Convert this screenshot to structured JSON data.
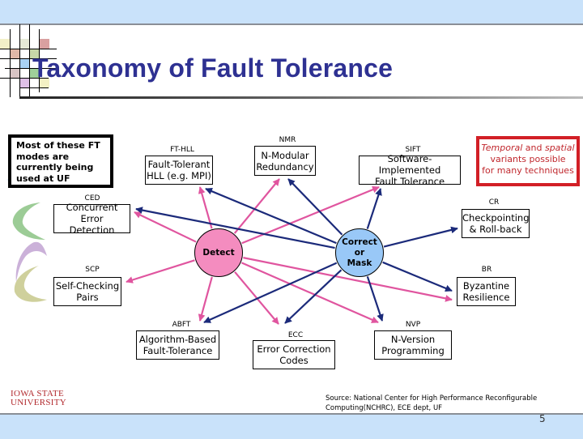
{
  "slide": {
    "title": "Taxonomy of Fault Tolerance",
    "page_number": "5",
    "logo": {
      "line1": "IOWA STATE",
      "line2": "UNIVERSITY"
    },
    "source": {
      "line1": "Source: National Center for High Performance Reconfigurable",
      "line2": "Computing(NCHRC), ECE dept, UF"
    }
  },
  "note_box": {
    "text": "Most of these FT modes are currently being used at UF"
  },
  "variant_box": {
    "temporal": "Temporal",
    "and": " and ",
    "spatial": "spatial",
    "line2": "variants possible",
    "line3": "for many techniques"
  },
  "hubs": {
    "detect": {
      "label": "Detect",
      "color": "#f48cbf"
    },
    "correct": {
      "line1": "Correct",
      "line2": "or",
      "line3": "Mask",
      "color": "#99c8f7"
    }
  },
  "arrow_colors": {
    "detect": "#e0559f",
    "correct": "#1b2a7a"
  },
  "nodes": [
    {
      "id": "fthll",
      "abbr": "FT-HLL",
      "line1": "Fault-Tolerant",
      "line2": "HLL (e.g. MPI)"
    },
    {
      "id": "nmr",
      "abbr": "NMR",
      "line1": "N-Modular",
      "line2": "Redundancy"
    },
    {
      "id": "sift",
      "abbr": "SIFT",
      "line1": "Software-Implemented",
      "line2": "Fault Tolerance"
    },
    {
      "id": "ced",
      "abbr": "CED",
      "line1": "Concurrent Error",
      "line2": "Detection"
    },
    {
      "id": "cr",
      "abbr": "CR",
      "line1": "Checkpointing",
      "line2": "& Roll-back"
    },
    {
      "id": "scp",
      "abbr": "SCP",
      "line1": "Self-Checking",
      "line2": "Pairs"
    },
    {
      "id": "br",
      "abbr": "BR",
      "line1": "Byzantine",
      "line2": "Resilience"
    },
    {
      "id": "abft",
      "abbr": "ABFT",
      "line1": "Algorithm-Based",
      "line2": "Fault-Tolerance"
    },
    {
      "id": "ecc",
      "abbr": "ECC",
      "line1": "Error Correction",
      "line2": "Codes"
    },
    {
      "id": "nvp",
      "abbr": "NVP",
      "line1": "N-Version",
      "line2": "Programming"
    }
  ],
  "edges": {
    "detect": [
      "fthll",
      "nmr",
      "sift",
      "ced",
      "scp",
      "br",
      "abft",
      "ecc",
      "nvp"
    ],
    "correct": [
      "fthll",
      "nmr",
      "sift",
      "ced",
      "cr",
      "br",
      "abft",
      "ecc",
      "nvp"
    ]
  }
}
